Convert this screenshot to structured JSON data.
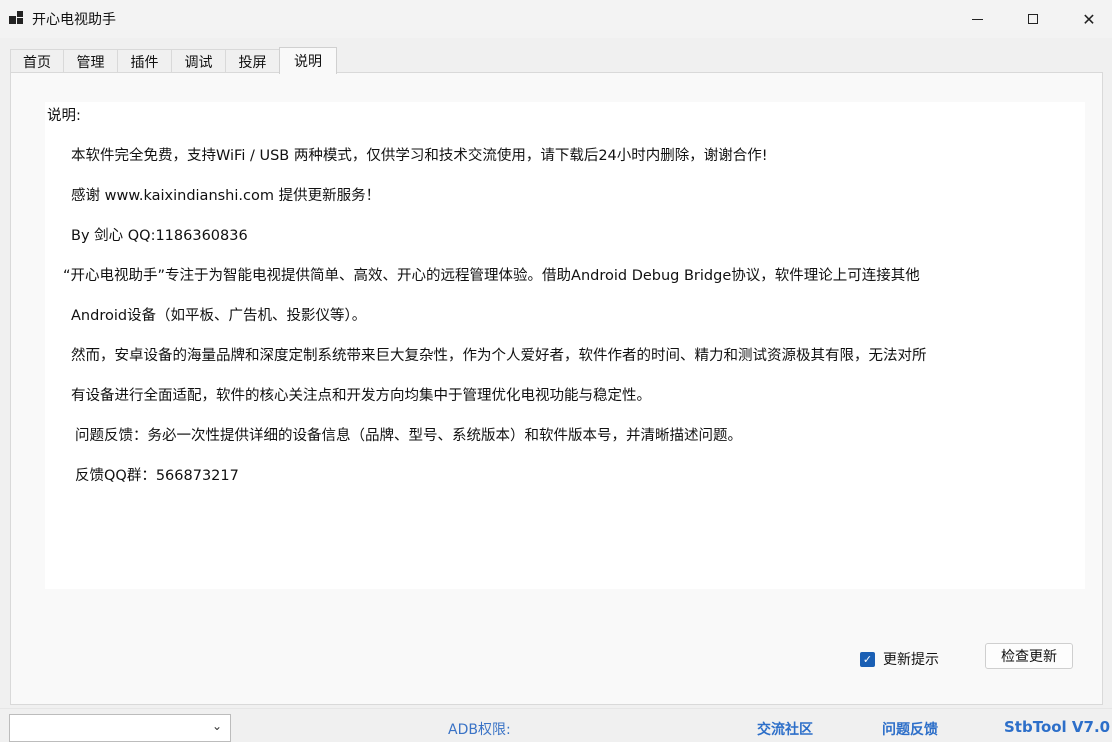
{
  "window": {
    "title": "开心电视助手",
    "minimize_icon": "minimize-icon",
    "maximize_icon": "maximize-icon",
    "close_icon": "close-icon",
    "close_glyph": "✕"
  },
  "tabs": [
    {
      "label": "首页"
    },
    {
      "label": "管理"
    },
    {
      "label": "插件"
    },
    {
      "label": "调试"
    },
    {
      "label": "投屏"
    },
    {
      "label": "说明",
      "active": true
    }
  ],
  "content": {
    "heading": "说明:",
    "lines": [
      "本软件完全免费，支持WiFi / USB 两种模式，仅供学习和技术交流使用，请下载后24小时内删除，谢谢合作!",
      "感谢 www.kaixindianshi.com  提供更新服务！",
      "By 剑心  QQ:1186360836",
      "“开心电视助手”专注于为智能电视提供简单、高效、开心的远程管理体验。借助Android Debug Bridge协议，软件理论上可连接其他",
      "Android设备（如平板、广告机、投影仪等）。",
      "然而，安卓设备的海量品牌和深度定制系统带来巨大复杂性，作为个人爱好者，软件作者的时间、精力和测试资源极其有限，无法对所",
      "有设备进行全面适配，软件的核心关注点和开发方向均集中于管理优化电视功能与稳定性。",
      "问题反馈：务必一次性提供详细的设备信息（品牌、型号、系统版本）和软件版本号，并清晰描述问题。",
      "反馈QQ群：566873217"
    ]
  },
  "update": {
    "checkbox_label": "更新提示",
    "checked": true,
    "check_mark": "✓",
    "button_label": "检查更新"
  },
  "statusbar": {
    "combo_value": "",
    "chevron_glyph": "⌄",
    "adb_label": "ADB权限:",
    "community_link": "交流社区",
    "feedback_link": "问题反馈",
    "version": "StbTool V7.0"
  },
  "colors": {
    "accent": "#1a5fb4",
    "link": "#2d6fc9"
  }
}
